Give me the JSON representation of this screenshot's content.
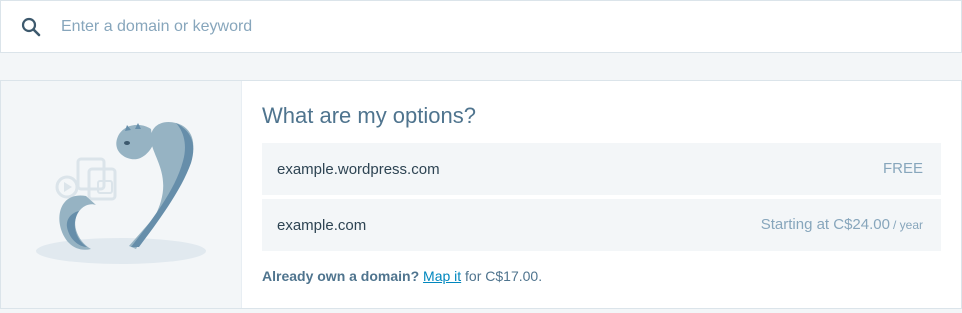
{
  "search": {
    "placeholder": "Enter a domain or keyword",
    "icon": "search-icon"
  },
  "options": {
    "title": "What are my options?",
    "rows": [
      {
        "domain": "example.wordpress.com",
        "price": "FREE",
        "per": ""
      },
      {
        "domain": "example.com",
        "price": "Starting at C$24.00",
        "per": "/ year"
      }
    ],
    "map": {
      "question": "Already own a domain?",
      "link": "Map it",
      "suffix": "for C$17.00."
    }
  },
  "colors": {
    "accent": "#0087be",
    "muted": "#87a6bc",
    "text": "#2e4453",
    "illustration": "#96b3c3"
  }
}
